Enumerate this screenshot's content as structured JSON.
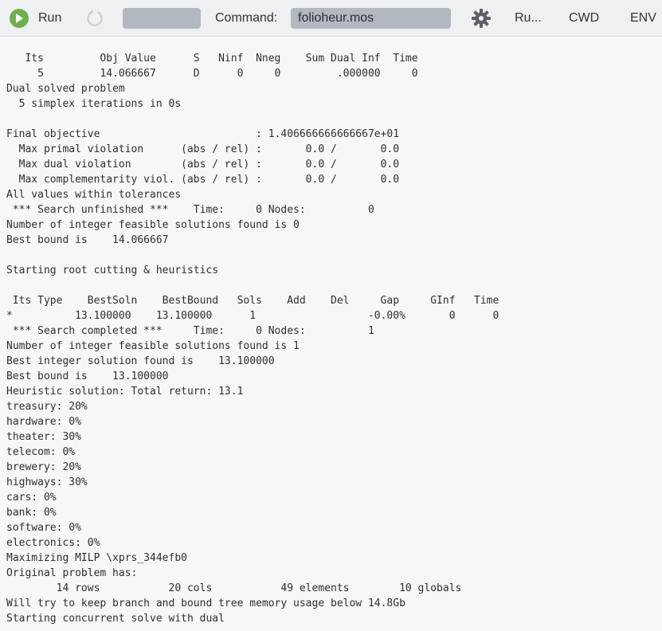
{
  "toolbar": {
    "run_label": "Run",
    "command_label": "Command:",
    "command_value": "folioheur.mos",
    "run_options_label": "Ru...",
    "cwd_label": "CWD",
    "env_label": "ENV",
    "icons": {
      "run": "play-icon",
      "reload": "reload-icon",
      "settings": "gear-icon"
    },
    "colors": {
      "run_icon": "#6ab04c",
      "field_bg": "#b2b8bf"
    }
  },
  "console": {
    "lines": [
      "   Its         Obj Value      S   Ninf  Nneg    Sum Dual Inf  Time",
      "     5         14.066667      D      0     0         .000000     0",
      "Dual solved problem",
      "  5 simplex iterations in 0s",
      "",
      "Final objective                         : 1.406666666666667e+01",
      "  Max primal violation      (abs / rel) :       0.0 /       0.0",
      "  Max dual violation        (abs / rel) :       0.0 /       0.0",
      "  Max complementarity viol. (abs / rel) :       0.0 /       0.0",
      "All values within tolerances",
      " *** Search unfinished ***    Time:     0 Nodes:          0",
      "Number of integer feasible solutions found is 0",
      "Best bound is    14.066667",
      "",
      "Starting root cutting & heuristics",
      "",
      " Its Type    BestSoln    BestBound   Sols    Add    Del     Gap     GInf   Time",
      "*          13.100000    13.100000      1                  -0.00%       0      0",
      " *** Search completed ***     Time:     0 Nodes:          1",
      "Number of integer feasible solutions found is 1",
      "Best integer solution found is    13.100000",
      "Best bound is    13.100000",
      "Heuristic solution: Total return: 13.1",
      "treasury: 20%",
      "hardware: 0%",
      "theater: 30%",
      "telecom: 0%",
      "brewery: 20%",
      "highways: 30%",
      "cars: 0%",
      "bank: 0%",
      "software: 0%",
      "electronics: 0%",
      "Maximizing MILP \\xprs_344efb0",
      "Original problem has:",
      "        14 rows           20 cols           49 elements        10 globals",
      "Will try to keep branch and bound tree memory usage below 14.8Gb",
      "Starting concurrent solve with dual"
    ]
  }
}
